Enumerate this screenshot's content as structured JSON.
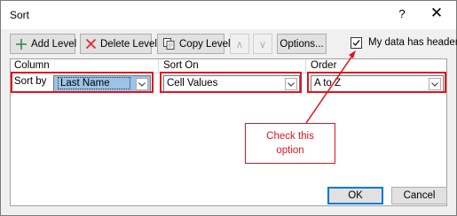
{
  "window": {
    "title": "Sort",
    "help_glyph": "?",
    "close_glyph": "✕"
  },
  "toolbar": {
    "add_level": "Add Level",
    "delete_level": "Delete Level",
    "copy_level": "Copy Level",
    "move_up_glyph": "∧",
    "move_down_glyph": "∨",
    "options": "Options..."
  },
  "headers_option": {
    "label": "My data has headers",
    "checked": true
  },
  "columns": {
    "column": "Column",
    "sort_on": "Sort On",
    "order": "Order"
  },
  "row": {
    "sort_by_label": "Sort by",
    "column_value": "Last Name",
    "sort_on_value": "Cell Values",
    "order_value": "A to Z"
  },
  "callout": {
    "line1": "Check this",
    "line2": "option"
  },
  "footer": {
    "ok": "OK",
    "cancel": "Cancel"
  },
  "colors": {
    "annotation_red": "#e0141e",
    "add_icon_green": "#2e8b3d",
    "delete_icon_red": "#d9262e",
    "selection_blue": "#9cc3e6",
    "focus_blue": "#0078d7"
  }
}
